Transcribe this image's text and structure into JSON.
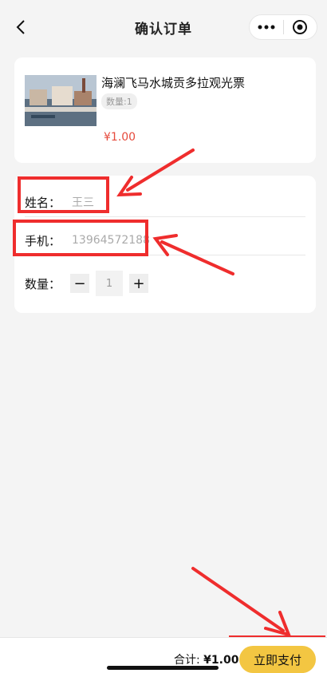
{
  "header": {
    "title": "确认订单"
  },
  "product": {
    "name": "海澜飞马水城贡多拉观光票",
    "quantity_badge": "数量:1",
    "price": "¥1.00"
  },
  "form": {
    "name_label": "姓名：",
    "name_value": "王三",
    "phone_label": "手机：",
    "phone_value": "13964572188",
    "quantity_label": "数量：",
    "quantity_value": "1",
    "minus": "−",
    "plus": "+"
  },
  "bottom": {
    "total_label": "合计:",
    "total_value": "¥1.00",
    "pay_label": "立即支付"
  },
  "colors": {
    "price": "#e64a3c",
    "pay_button": "#f3c642",
    "annotation": "#ef2d2d"
  },
  "icons": [
    "back-arrow-icon",
    "more-dots-icon",
    "close-circle-icon"
  ]
}
